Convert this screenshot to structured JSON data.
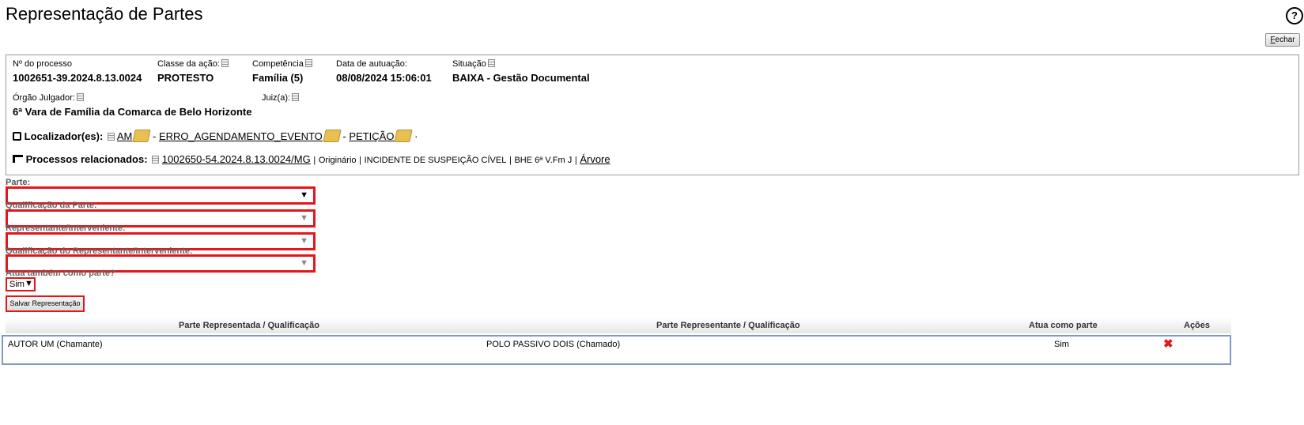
{
  "title": "Representação de Partes",
  "help_icon": "question-circle-icon",
  "fechar_label": "Fechar",
  "process": {
    "numero_label": "Nº do processo",
    "numero": "1002651-39.2024.8.13.0024",
    "classe_label": "Classe da ação:",
    "classe": "PROTESTO",
    "competencia_label": "Competência",
    "competencia": "Família (5)",
    "data_label": "Data de autuação:",
    "data": "08/08/2024 15:06:01",
    "situacao_label": "Situação",
    "situacao": "BAIXA - Gestão Documental",
    "orgao_label": "Órgão Julgador:",
    "orgao": "6ª Vara de Família da Comarca de Belo Horizonte",
    "juiz_label": "Juiz(a):"
  },
  "localizadores": {
    "label": "Localizador(es):",
    "items": [
      "AM",
      "ERRO_AGENDAMENTO_EVENTO",
      "PETIÇÃO"
    ],
    "sep": "-",
    "end": "·"
  },
  "relacionados": {
    "label": "Processos relacionados:",
    "numero": "1002650-54.2024.8.13.0024/MG",
    "tipo": "Originário",
    "classe": "INCIDENTE DE SUSPEIÇÃO CÍVEL",
    "orgao": "BHE 6ª V.Fm J",
    "arvore": "Árvore"
  },
  "form": {
    "parte_label": "Parte:",
    "qualif_parte_label": "Qualificação da Parte:",
    "representante_label": "Representante/Interveniente:",
    "qualif_rep_label": "Qualificação do Representante/Interveniente:",
    "atua_label": "Atua também como parte?",
    "atua_value": "Sim",
    "salvar_label": "Salvar Representação"
  },
  "table": {
    "headers": [
      "Parte Representada / Qualificação",
      "Parte Representante / Qualificação",
      "Atua como parte",
      "Ações"
    ],
    "rows": [
      {
        "representada": "AUTOR UM (Chamante)",
        "representante": "POLO PASSIVO DOIS (Chamado)",
        "atua": "Sim",
        "acao_icon": "delete-x-icon"
      }
    ]
  },
  "colors": {
    "accent_red": "#e2171b",
    "row_border": "#7f98c8"
  }
}
